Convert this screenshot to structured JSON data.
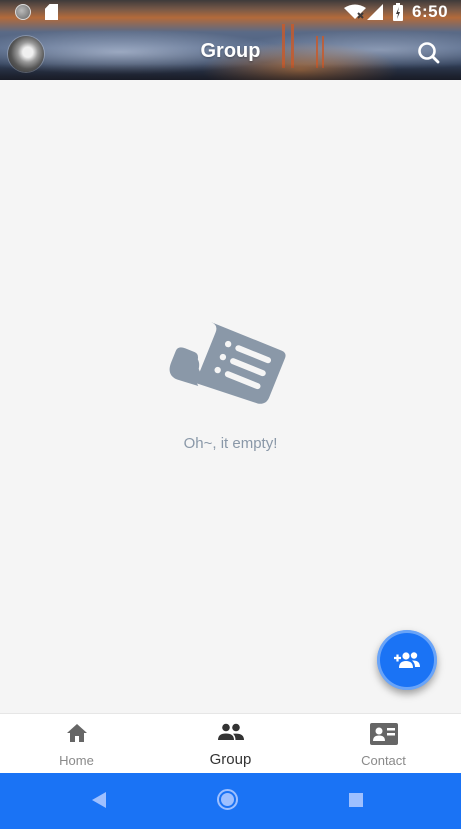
{
  "status_bar": {
    "time": "6:50",
    "icons": [
      "record-dot-icon",
      "sd-card-icon",
      "wifi-icon",
      "cell-signal-icon",
      "battery-icon"
    ]
  },
  "app_bar": {
    "title": "Group",
    "left_icon": "avatar",
    "right_icon": "search-icon"
  },
  "empty_state": {
    "icon": "document-list-icon",
    "message": "Oh~, it empty!"
  },
  "fab": {
    "icon": "add-group-icon",
    "color": "#1a73f5"
  },
  "bottom_nav": {
    "items": [
      {
        "label": "Home",
        "icon": "home-icon",
        "active": false
      },
      {
        "label": "Group",
        "icon": "group-icon",
        "active": true
      },
      {
        "label": "Contact",
        "icon": "contact-card-icon",
        "active": false
      }
    ]
  },
  "system_nav": {
    "buttons": [
      "back-icon",
      "home-circle-icon",
      "recents-square-icon"
    ],
    "color": "#1a73f5"
  },
  "colors": {
    "background": "#f5f5f5",
    "accent": "#1a73f5",
    "empty_text": "#8a98a8",
    "icon_muted": "#8a98a8",
    "nav_active": "#333333",
    "nav_inactive": "#8a8a8a"
  }
}
